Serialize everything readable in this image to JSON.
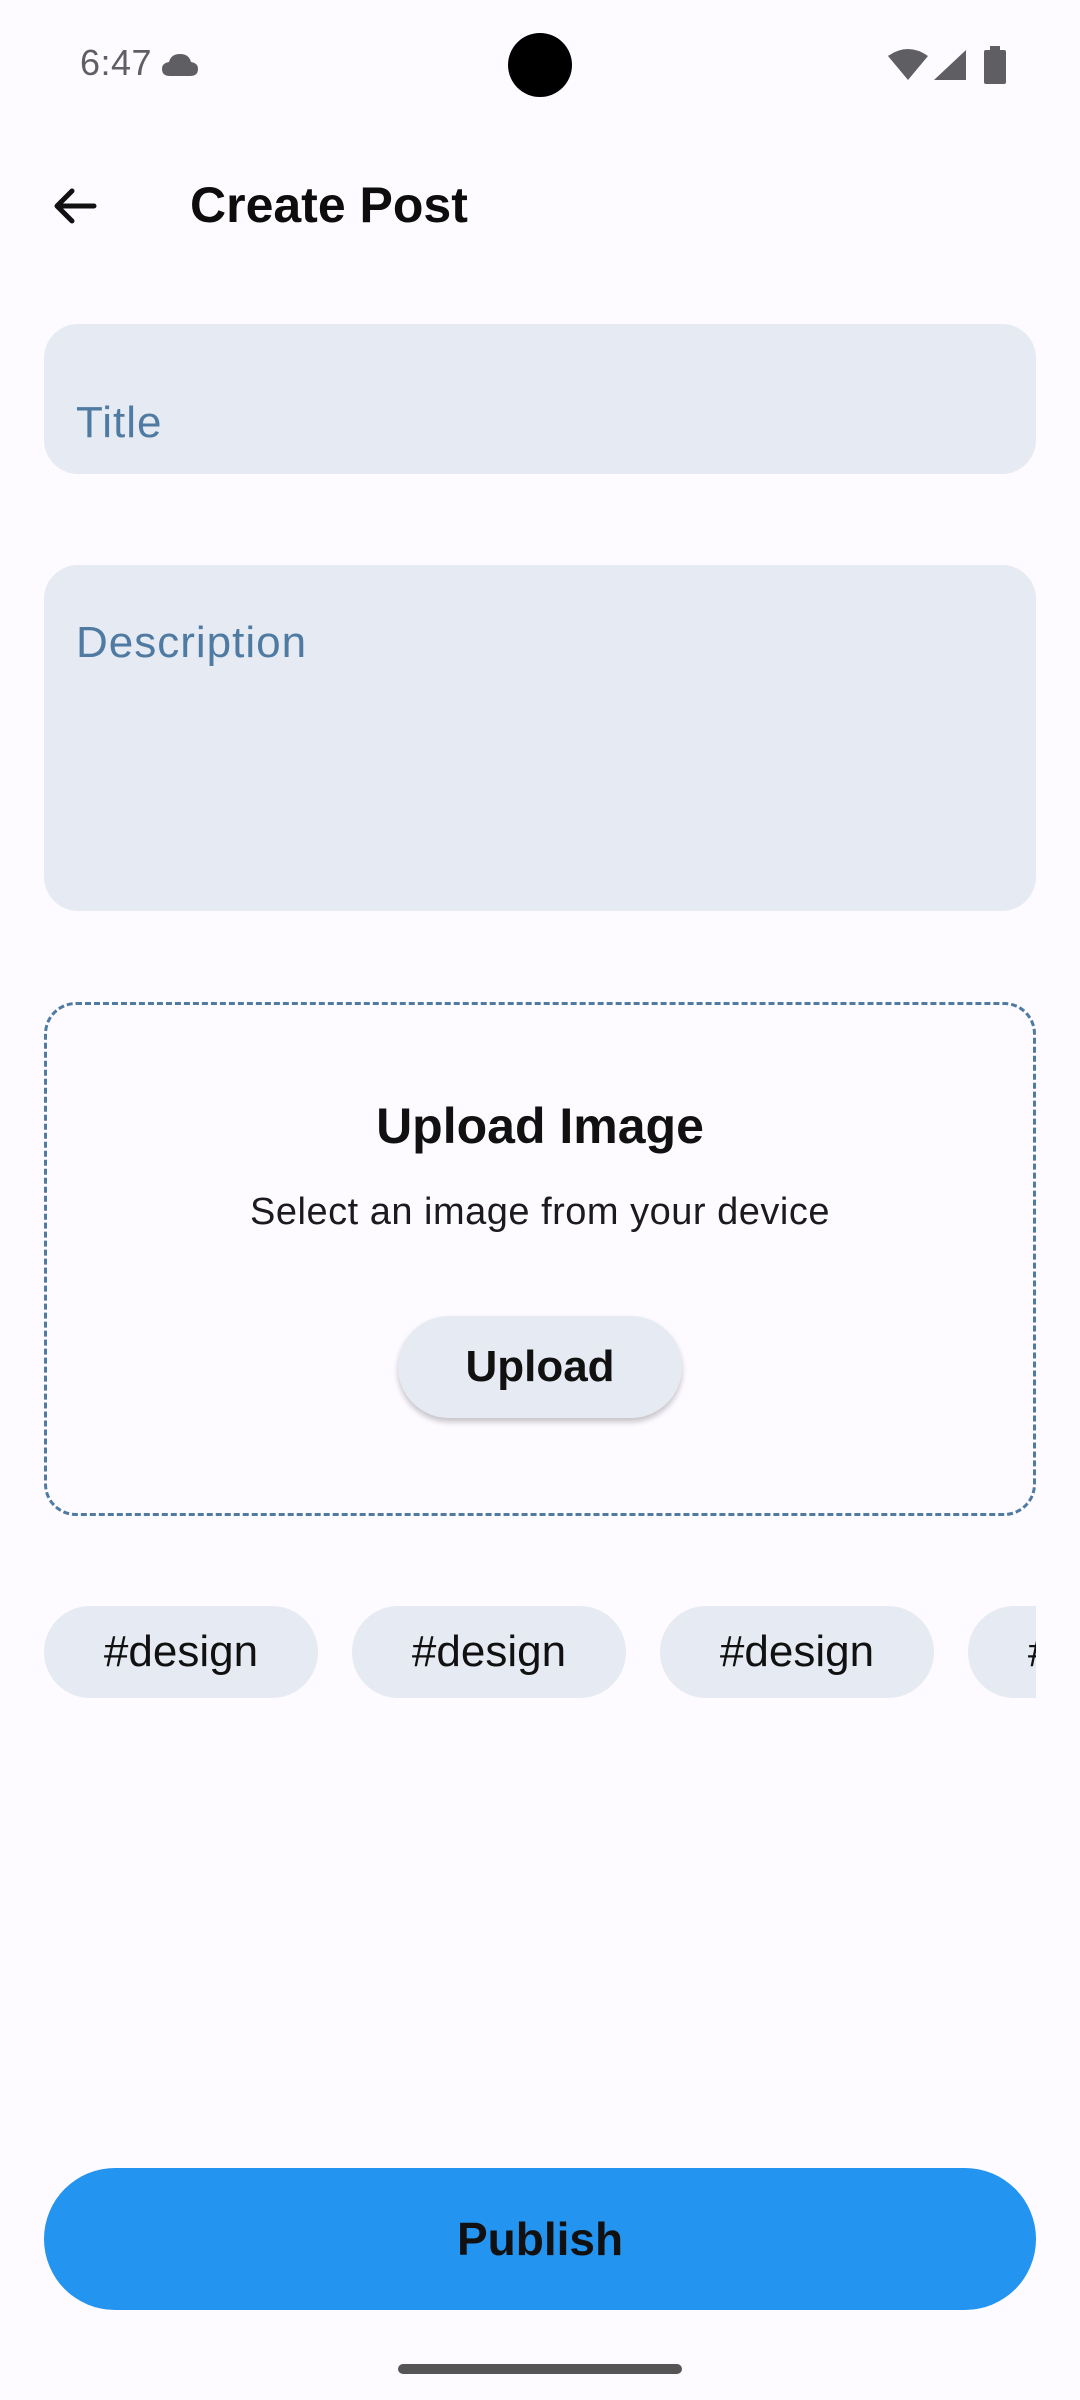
{
  "status_bar": {
    "time": "6:47",
    "icons": [
      "cloud-icon",
      "wifi-icon",
      "signal-icon",
      "battery-icon"
    ]
  },
  "app_bar": {
    "back_icon": "arrow-back-icon",
    "title": "Create Post"
  },
  "form": {
    "title_field": {
      "value": "",
      "placeholder": "Title"
    },
    "description_field": {
      "value": "",
      "placeholder": "Description"
    }
  },
  "upload": {
    "title": "Upload Image",
    "subtitle": "Select an image from your device",
    "button_label": "Upload"
  },
  "tags": [
    "#design",
    "#design",
    "#design",
    "#design"
  ],
  "publish_label": "Publish",
  "colors": {
    "background": "#fdfbff",
    "field_background": "#e6eaf3",
    "placeholder": "#4f7aa2",
    "dashed_border": "#4f7aa2",
    "publish_button": "#2394ef"
  }
}
